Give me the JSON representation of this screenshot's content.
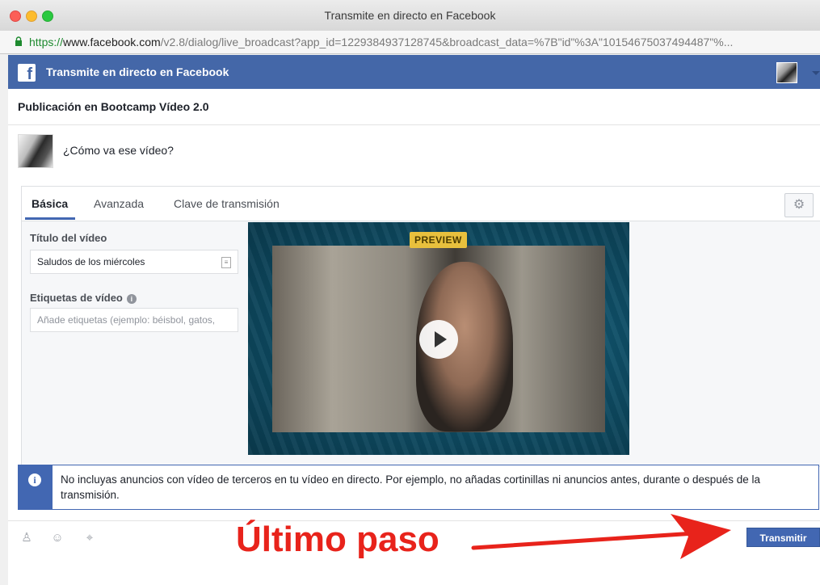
{
  "window": {
    "title": "Transmite en directo en Facebook"
  },
  "address_bar": {
    "scheme": "https://",
    "host": "www.facebook.com",
    "path": "/v2.8/dialog/live_broadcast?app_id=1229384937128745&broadcast_data=%7B\"id\"%3A\"10154675037494487\"%..."
  },
  "fb_header": {
    "title": "Transmite en directo en Facebook"
  },
  "post": {
    "heading": "Publicación en Bootcamp Vídeo 2.0",
    "status_text": "¿Cómo va ese vídeo?"
  },
  "tabs": [
    {
      "label": "Básica",
      "active": true
    },
    {
      "label": "Avanzada",
      "active": false
    },
    {
      "label": "Clave de transmisión",
      "active": false
    }
  ],
  "form": {
    "title_label": "Título del vídeo",
    "title_value": "Saludos de los miércoles",
    "tags_label": "Etiquetas de vídeo",
    "tags_placeholder": "Añade etiquetas (ejemplo: béisbol, gatos, etc.)"
  },
  "preview": {
    "badge": "PREVIEW"
  },
  "notice": {
    "text": "No incluyas anuncios con vídeo de terceros en tu vídeo en directo. Por ejemplo, no añadas cortinillas ni anuncios antes, durante o después de la transmisión."
  },
  "footer": {
    "broadcast_button": "Transmitir"
  },
  "annotation": {
    "text": "Último paso"
  },
  "colors": {
    "facebook_blue": "#4267b2",
    "header_blue": "#4467a8",
    "annotation_red": "#e8231b",
    "badge_yellow": "#e8c03d"
  }
}
